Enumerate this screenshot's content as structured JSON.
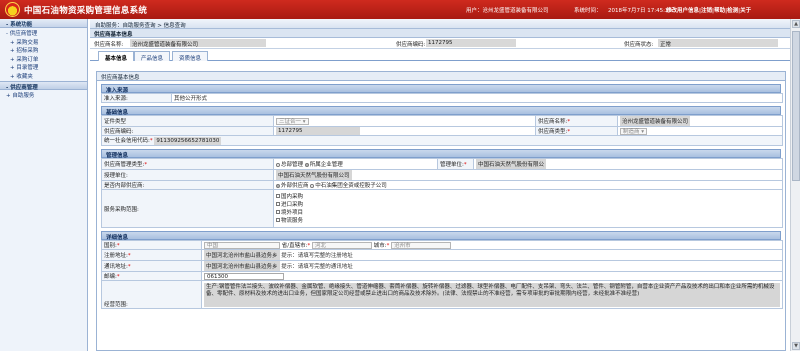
{
  "header": {
    "title": "中国石油物资采购管理信息系统",
    "user": "用户：沧州龙盛管道装备有限公司",
    "time_label": "系统时间：",
    "time": "2018年7月7日 17:45:29",
    "links": [
      "修改用户信息",
      "注销",
      "帮助",
      "检测",
      "关于"
    ]
  },
  "sidebar": {
    "title": "系统功能",
    "items": [
      "供应商管理",
      "采购交易",
      "招标采购",
      "采购订单",
      "目录管理",
      "收藏夹"
    ],
    "section": "供应商管理",
    "sub_items": [
      "自助服务"
    ]
  },
  "breadcrumb": "自助服务：自助服务查询 > 信息查询",
  "basic": {
    "section": "供应商基本信息",
    "name_label": "供应商名称:",
    "name": "沧州龙盛管道装备有限公司",
    "code_label": "供应商编码:",
    "code": "1172795",
    "status_label": "供应商状态:",
    "status": "正常"
  },
  "tabs": [
    "基本信息",
    "产品信息",
    "资质信息"
  ],
  "inner_title": "供应商基本信息",
  "access": {
    "title": "准入来源",
    "label": "准入来源:",
    "value": "其他公开形式"
  },
  "base": {
    "title": "基础信息",
    "cert_label": "证件类型",
    "cert_value": "三证合一",
    "name_label": "供应商名称:",
    "name": "沧州龙盛管道装备有限公司",
    "code_label": "供应商编码:",
    "code": "1172795",
    "type_label": "供应商类型:",
    "type": "制造商",
    "credit_label": "统一社会信用代码:",
    "credit": "911309256652781030"
  },
  "manage": {
    "title": "管理信息",
    "mgmt_type_label": "供应商管理类型:",
    "opt_general": "总部管理",
    "opt_local": "所属企业管理",
    "unit_label": "管理单位:",
    "unit": "中国石油天然气股份有限公",
    "auth_label": "授理单位:",
    "auth": "中国石油天然气股份有限公司",
    "internal_label": "是否内部供应商:",
    "opt_external": "外部供应商",
    "opt_internal": "中石油集团全资或控股子公司",
    "scope_label": "服务采购范围:",
    "scope_opts": [
      "国内采购",
      "进口采购",
      "境外项目",
      "物流服务"
    ]
  },
  "detail": {
    "title": "详细信息",
    "country_label": "国别:",
    "country": "中国",
    "province_label": "省/直辖市:",
    "province": "河北",
    "city_label": "城市:",
    "city": "沧州市",
    "reg_addr_label": "注册地址:",
    "reg_addr": "中国河北沧州市盐山县边务乡",
    "reg_hint": "提示：请填写完整的注册地址",
    "mail_addr_label": "通讯地址:",
    "mail_addr": "中国河北沧州市盐山县边务乡",
    "mail_hint": "提示：请填写完整的通讯地址",
    "zip_label": "邮编:",
    "zip": "061300",
    "scope_label": "经营范围:",
    "scope": "生产:钢管管件法兰接头、波纹补偿器、金属软管、绝缘接头、管道伸缩器、套筒补偿器、旋转补偿器、过滤器、球型补偿器、电厂配件、支吊架、弯头、法兰、管件、钢管附管，自营本企业资产产品及技术的出口和本企业所需的机械设备、零配件、原材料及技术的进出口业务，但国家限定公司经营或禁止进出口的商品及技术除外。(法律、法规禁止的不准经营，需专项审批的审批期限内经营，未经批准不准经营)"
  }
}
